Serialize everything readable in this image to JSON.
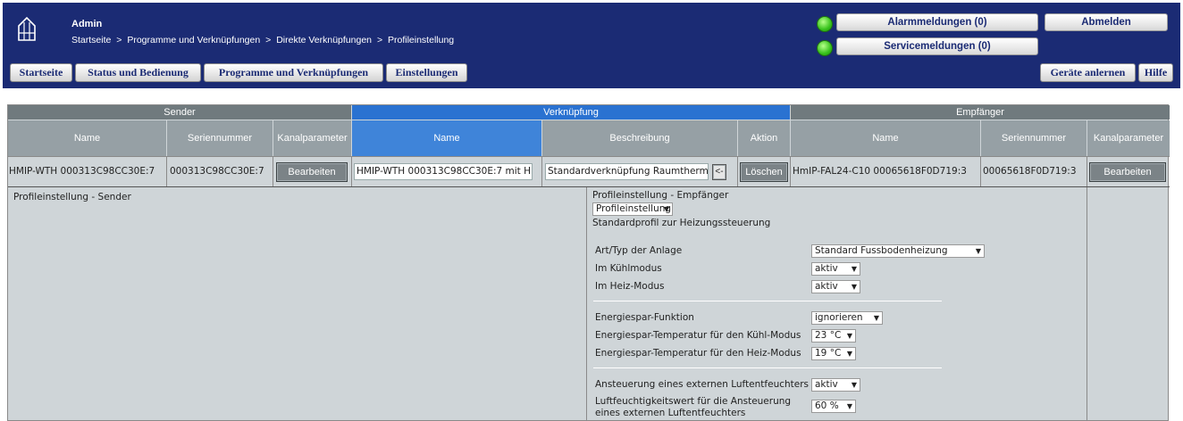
{
  "header": {
    "user": "Admin",
    "breadcrumb": [
      "Startseite",
      ">",
      "Programme und Verknüpfungen",
      ">",
      "Direkte Verknüpfungen",
      ">",
      "Profileinstellung"
    ],
    "alarm_label": "Alarmmeldungen (0)",
    "service_label": "Servicemeldungen (0)",
    "logout_label": "Abmelden",
    "nav": [
      "Startseite",
      "Status und Bedienung",
      "Programme und Verknüpfungen",
      "Einstellungen"
    ],
    "teach_label": "Geräte anlernen",
    "help_label": "Hilfe"
  },
  "table": {
    "groups": {
      "sender": "Sender",
      "link": "Verknüpfung",
      "receiver": "Empfänger"
    },
    "columns": {
      "s_name": "Name",
      "s_serial": "Seriennummer",
      "s_param": "Kanalparameter",
      "l_name": "Name",
      "l_desc": "Beschreibung",
      "l_action": "Aktion",
      "r_name": "Name",
      "r_serial": "Seriennummer",
      "r_param": "Kanalparameter"
    },
    "row": {
      "s_name": "HMIP-WTH 000313C98CC30E:7",
      "s_serial": "000313C98CC30E:7",
      "s_edit": "Bearbeiten",
      "l_name": "HMIP-WTH 000313C98CC30E:7 mit H",
      "l_desc": "Standardverknüpfung Raumtherm",
      "l_arrow": "<-",
      "l_delete": "Löschen",
      "r_name": "HmIP-FAL24-C10 00065618F0D719:3",
      "r_serial": "00065618F0D719:3",
      "r_edit": "Bearbeiten"
    }
  },
  "sender_panel": {
    "title": "Profileinstellung - Sender"
  },
  "receiver_panel": {
    "title": "Profileinstellung - Empfänger",
    "profile_select": "Profileinstellung",
    "profile_desc": "Standardprofil zur Heizungssteuerung",
    "rows": [
      {
        "label": "Art/Typ der Anlage",
        "value": "Standard Fussbodenheizung"
      },
      {
        "label": "Im Kühlmodus",
        "value": "aktiv"
      },
      {
        "label": "Im Heiz-Modus",
        "value": "aktiv"
      },
      {
        "label": "Energiespar-Funktion",
        "value": "ignorieren"
      },
      {
        "label": "Energiespar-Temperatur für den Kühl-Modus",
        "value": "23 °C"
      },
      {
        "label": "Energiespar-Temperatur für den Heiz-Modus",
        "value": "19 °C"
      },
      {
        "label": "Ansteuerung eines externen Luftentfeuchters",
        "value": "aktiv"
      },
      {
        "label": "Luftfeuchtigkeitswert für die Ansteuerung",
        "value": "60 %"
      }
    ],
    "last_label_line2": "eines externen Luftentfeuchters"
  },
  "colors": {
    "header_bg": "#1b2b74",
    "link_blue": "#2a72d1",
    "gray_header": "#707a7e",
    "panel_bg": "#cfd5d8"
  },
  "icons": {
    "logo": "house-logo-icon",
    "status": "green-led-icon",
    "dropdown": "triangle-down-icon"
  }
}
